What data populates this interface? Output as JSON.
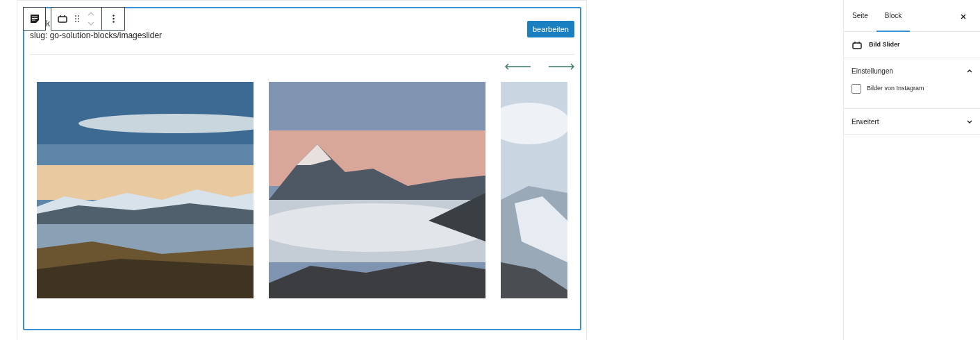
{
  "block": {
    "title_fragment": "k",
    "slug": "slug: go-solution-blocks/imageslider",
    "edit_button": "bearbeiten"
  },
  "sidebar": {
    "tabs": [
      {
        "label": "Seite",
        "selected": false
      },
      {
        "label": "Block",
        "selected": true
      }
    ],
    "block_name": "Bild Slider",
    "panels": [
      {
        "title": "Einstellungen",
        "expanded": true,
        "options": [
          {
            "label": "Bilder von Instagram",
            "checked": false
          }
        ]
      },
      {
        "title": "Erweitert",
        "expanded": false
      }
    ]
  }
}
